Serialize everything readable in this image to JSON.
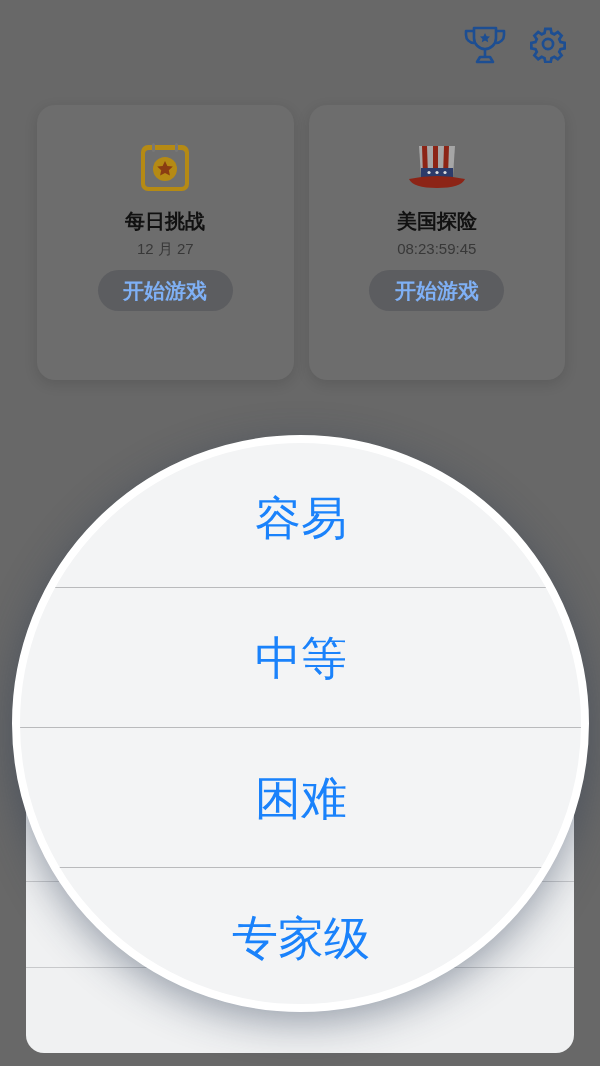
{
  "cards": [
    {
      "kind": "calendar",
      "title": "每日挑战",
      "subtitle": "12 月 27",
      "button": "开始游戏"
    },
    {
      "kind": "hat",
      "title": "美国探险",
      "subtitle": "08:23:59:45",
      "button": "开始游戏"
    }
  ],
  "magnifier": {
    "options": [
      "容易",
      "中等",
      "困难",
      "专家级"
    ]
  }
}
